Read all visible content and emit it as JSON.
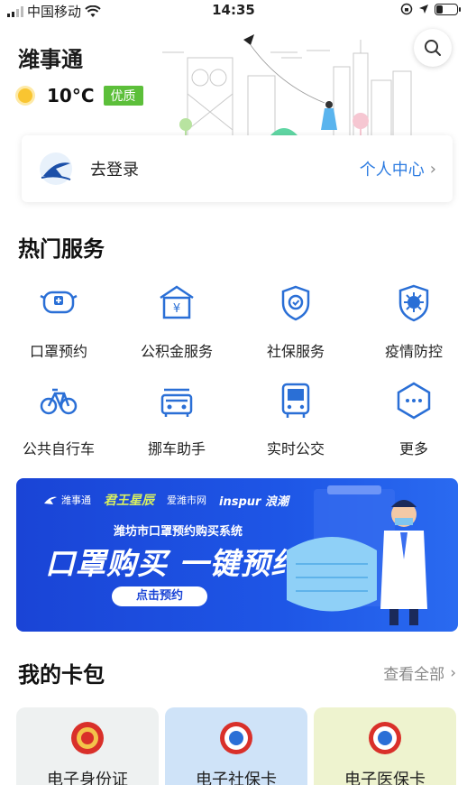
{
  "status_bar": {
    "carrier": "中国移动",
    "time": "14:35",
    "battery_level": 0.35
  },
  "header": {
    "app_title": "潍事通",
    "temperature": "10°C",
    "air_quality": "优质",
    "weather_icon": "sun-icon",
    "search_icon": "search-icon"
  },
  "login": {
    "label": "去登录",
    "personal_center": "个人中心",
    "chevron": "›"
  },
  "hot_services": {
    "title": "热门服务",
    "items": [
      {
        "label": "口罩预约",
        "icon": "mask-icon"
      },
      {
        "label": "公积金服务",
        "icon": "fund-icon"
      },
      {
        "label": "社保服务",
        "icon": "shield-icon"
      },
      {
        "label": "疫情防控",
        "icon": "virus-shield-icon"
      },
      {
        "label": "公共自行车",
        "icon": "bicycle-icon"
      },
      {
        "label": "挪车助手",
        "icon": "car-icon"
      },
      {
        "label": "实时公交",
        "icon": "bus-icon"
      },
      {
        "label": "更多",
        "icon": "more-icon"
      }
    ]
  },
  "banner": {
    "partners": [
      "潍事通",
      "君王星辰",
      "爱潍市网",
      "inspur 浪潮"
    ],
    "subtitle": "潍坊市口罩预约购买系统",
    "headline": "口罩购买 一键预约",
    "cta": "点击预约"
  },
  "card_pack": {
    "title": "我的卡包",
    "view_all": "查看全部",
    "chevron": "›",
    "cards": [
      {
        "label": "电子身份证",
        "color": "#eef1f1"
      },
      {
        "label": "电子社保卡",
        "color": "#cfe3f8"
      },
      {
        "label": "电子医保卡",
        "color": "#eef3cf"
      }
    ]
  },
  "colors": {
    "accent": "#2f7de1",
    "icon_blue": "#2a6fd6",
    "aqi_green": "#5cbf3a",
    "banner_blue": "#1a44d6"
  }
}
